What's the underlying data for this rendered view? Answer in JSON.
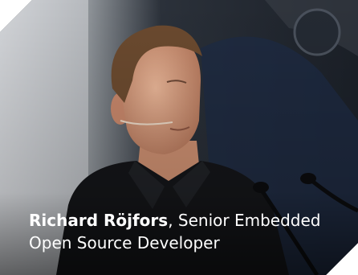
{
  "caption": {
    "name": "Richard Röjfors",
    "separator": ", ",
    "role_line1": "Senior Embedded",
    "role_line2": "Open Source Developer"
  },
  "photo": {
    "subject": "speaker-with-headset-microphone",
    "background_color": "#1b1f27",
    "shirt_color": "#141518",
    "skin_color": "#d9a184",
    "hair_color": "#6b4a2f"
  }
}
